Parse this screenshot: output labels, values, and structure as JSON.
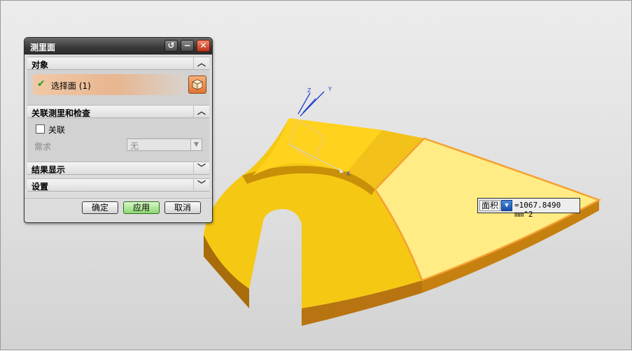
{
  "dialog": {
    "title": "测里面",
    "sections": {
      "object": {
        "label": "对象",
        "select_text": "选择面 (1)"
      },
      "associative": {
        "label": "关联测里和检查",
        "checkbox_label": "关联",
        "requirement_label": "需求",
        "requirement_value": "无"
      },
      "results": {
        "label": "结果显示"
      },
      "settings": {
        "label": "设置"
      }
    },
    "buttons": {
      "ok": "确定",
      "apply": "应用",
      "cancel": "取消"
    }
  },
  "measurement": {
    "field": "面积",
    "value": "=1067.8490 mm^2"
  },
  "axes": {
    "x": "X",
    "y": "Y",
    "z": "Z"
  },
  "colors": {
    "part_face": "#f5c814",
    "part_side": "#a86c0a",
    "selected_face": "#ffec85",
    "highlight_edge": "#f5a030",
    "title_bar": "#3a3a3a"
  },
  "icons": {
    "check": "check-icon",
    "collapse": "chevron-up-icon",
    "expand": "chevron-down-icon",
    "face_select": "cube-icon"
  }
}
